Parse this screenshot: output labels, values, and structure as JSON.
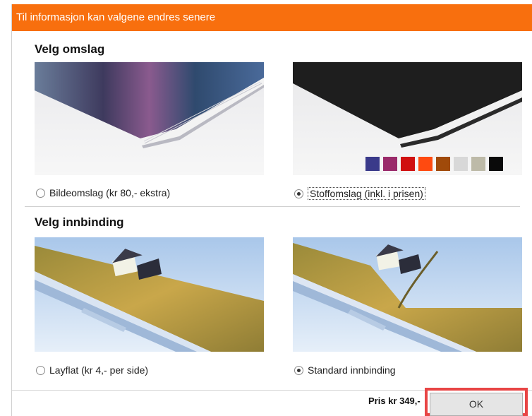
{
  "dialog": {
    "title": "Til informasjon kan valgene endres senere"
  },
  "cover_section": {
    "heading": "Velg omslag",
    "options": [
      {
        "label": "Bildeomslag (kr 80,- ekstra)",
        "selected": false
      },
      {
        "label": "Stoffomslag (inkl. i prisen)",
        "selected": true
      }
    ],
    "fabric_colors": [
      "#3a3a8a",
      "#9a2a6a",
      "#d01010",
      "#ff4a10",
      "#a04a0a",
      "#d8d8d8",
      "#bdbaa8",
      "#0a0a0a"
    ]
  },
  "binding_section": {
    "heading": "Velg innbinding",
    "options": [
      {
        "label": "Layflat (kr 4,- per side)",
        "selected": false
      },
      {
        "label": "Standard innbinding",
        "selected": true
      }
    ]
  },
  "footer": {
    "price": "Pris kr 349,-",
    "ok_label": "OK"
  },
  "colors": {
    "title_bar": "#f86f0e",
    "ok_highlight": "#e84545"
  }
}
